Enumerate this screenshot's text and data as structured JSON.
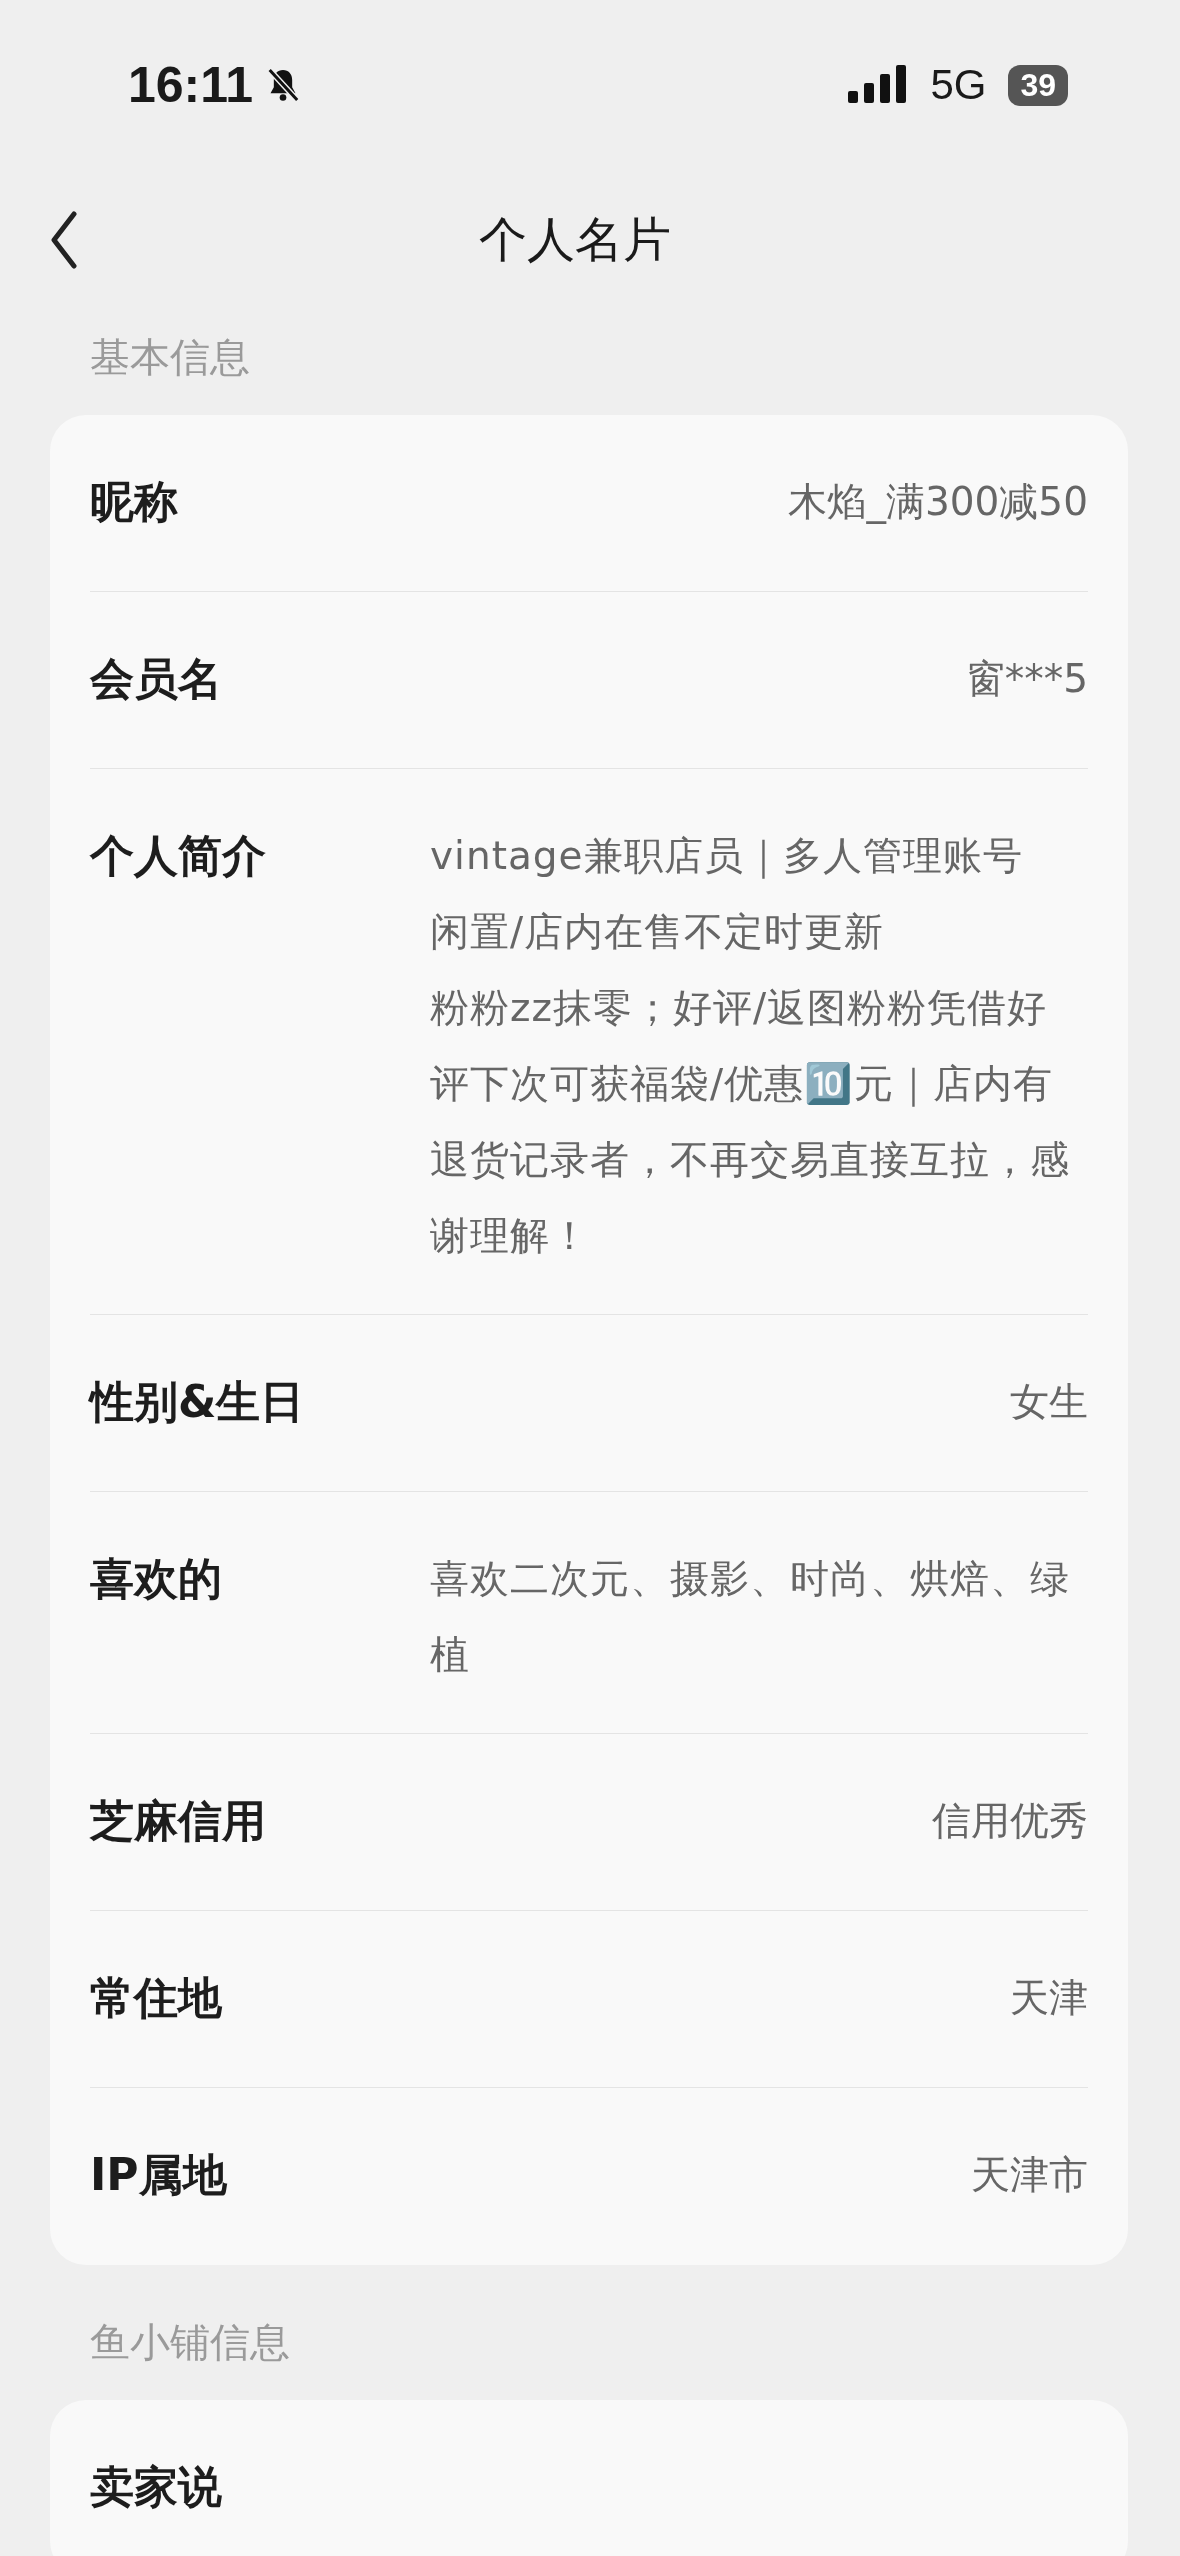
{
  "status_bar": {
    "time": "16:11",
    "network": "5G",
    "battery": "39"
  },
  "nav": {
    "title": "个人名片"
  },
  "sections": [
    {
      "title": "基本信息",
      "rows": [
        {
          "label": "昵称",
          "kind": "inline",
          "value": "木焰_满300减50"
        },
        {
          "label": "会员名",
          "kind": "inline",
          "value": "窗***5"
        },
        {
          "label": "个人简介",
          "kind": "lines",
          "paragraphs": [
            "vintage兼职店员｜多人管理账号",
            "闲置/店内在售不定时更新",
            "粉粉zz抹零；好评/返图粉粉凭借好评下次可获福袋/优惠🔟元｜店内有退货记录者，不再交易直接互拉，感谢理解！"
          ]
        },
        {
          "label": "性别&生日",
          "kind": "inline",
          "value": "女生"
        },
        {
          "label": "喜欢的",
          "kind": "block",
          "value": "喜欢二次元、摄影、时尚、烘焙、绿植"
        },
        {
          "label": "芝麻信用",
          "kind": "inline",
          "value": "信用优秀"
        },
        {
          "label": "常住地",
          "kind": "inline",
          "value": "天津"
        },
        {
          "label": "IP属地",
          "kind": "inline",
          "value": "天津市"
        }
      ]
    },
    {
      "title": "鱼小铺信息",
      "rows": [
        {
          "label": "卖家说",
          "kind": "inline"
        }
      ]
    }
  ]
}
